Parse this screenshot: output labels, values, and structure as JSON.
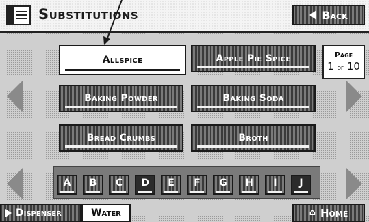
{
  "header": {
    "title": "Substitutions",
    "back_label": "Back"
  },
  "items": [
    {
      "label": "Allspice",
      "selected": true
    },
    {
      "label": "Apple Pie Spice",
      "selected": false
    },
    {
      "label": "Baking Powder",
      "selected": false
    },
    {
      "label": "Baking Soda",
      "selected": false
    },
    {
      "label": "Bread Crumbs",
      "selected": false
    },
    {
      "label": "Broth",
      "selected": false
    }
  ],
  "pagination": {
    "label": "Page",
    "current": "1",
    "of": "of",
    "total": "10"
  },
  "alphabet": [
    {
      "letter": "A",
      "active": false
    },
    {
      "letter": "B",
      "active": false
    },
    {
      "letter": "C",
      "active": false
    },
    {
      "letter": "D",
      "active": true
    },
    {
      "letter": "E",
      "active": false
    },
    {
      "letter": "F",
      "active": false
    },
    {
      "letter": "G",
      "active": false
    },
    {
      "letter": "H",
      "active": false
    },
    {
      "letter": "I",
      "active": false
    },
    {
      "letter": "J",
      "active": true
    }
  ],
  "footer": {
    "dispenser_label": "Dispenser",
    "water_label": "Water",
    "home_label": "Home"
  },
  "icons": {
    "title": "recipe-book-icon",
    "back": "triangle-left-icon",
    "dispenser": "triangle-right-icon",
    "home": "house-icon",
    "nav_prev": "arrow-left-icon",
    "nav_next": "arrow-right-icon"
  }
}
